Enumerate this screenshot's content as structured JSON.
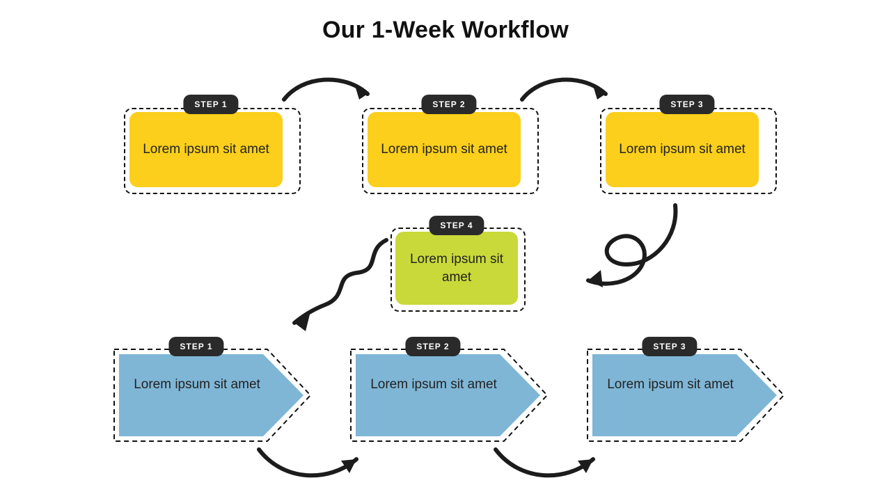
{
  "title": "Our 1-Week Workflow",
  "colors": {
    "yellow": "#fbcf1c",
    "lime": "#c9d93a",
    "blue": "#7fb6d6",
    "pill": "#2a2a2a"
  },
  "row1": [
    {
      "label": "STEP 1",
      "text": "Lorem ipsum sit amet"
    },
    {
      "label": "STEP 2",
      "text": "Lorem ipsum sit amet"
    },
    {
      "label": "STEP 3",
      "text": "Lorem ipsum sit amet"
    }
  ],
  "center": {
    "label": "STEP 4",
    "text": "Lorem ipsum sit amet"
  },
  "row3": [
    {
      "label": "STEP 1",
      "text": "Lorem ipsum sit amet"
    },
    {
      "label": "STEP 2",
      "text": "Lorem ipsum sit amet"
    },
    {
      "label": "STEP 3",
      "text": "Lorem ipsum sit amet"
    }
  ]
}
